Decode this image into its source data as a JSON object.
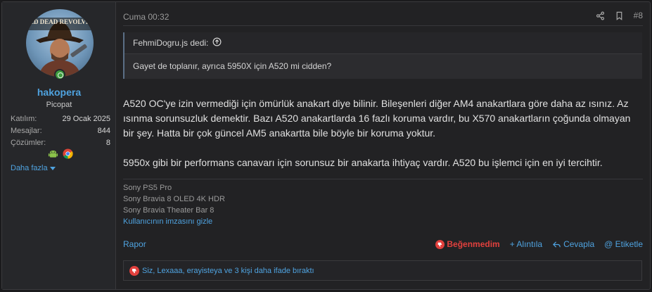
{
  "user": {
    "name": "hakopera",
    "title": "Picopat",
    "stats": [
      {
        "key": "Katılım:",
        "value": "29 Ocak 2025"
      },
      {
        "key": "Mesajlar:",
        "value": "844"
      },
      {
        "key": "Çözümler:",
        "value": "8"
      }
    ],
    "badges": [
      "android-icon",
      "chrome-icon"
    ],
    "more_label": "Daha fazla",
    "avatar_text": "RED DEAD REVOLVER"
  },
  "post": {
    "date": "Cuma 00:32",
    "number": "#8",
    "quote": {
      "author_line": "FehmiDogru.js dedi:",
      "text": "Gayet de toplanır, ayrıca 5950X için A520 mi cidden?"
    },
    "paragraphs": [
      "A520 OC'ye izin vermediği için ömürlük anakart diye bilinir. Bileşenleri diğer AM4 anakartlara göre daha az ısınız. Az ısınma sorunsuzluk demektir. Bazı A520 anakartlarda 16 fazlı koruma vardır, bu X570 anakartların çoğunda olmayan bir şey. Hatta bir çok güncel AM5 anakartta bile böyle bir koruma yoktur.",
      "5950x gibi bir performans canavarı için sorunsuz bir anakarta ihtiyaç vardır. A520 bu işlemci için en iyi tercihtir."
    ],
    "signature": [
      "Sony PS5 Pro",
      "Sony Bravia 8 OLED 4K HDR",
      "Sony Bravia Theater Bar 8"
    ],
    "signature_toggle": "Kullanıcının imzasını gizle"
  },
  "footer": {
    "report": "Rapor",
    "dislike": "Beğenmedim",
    "quote": "+ Alıntıla",
    "reply": "Cevapla",
    "tag": "@ Etiketle"
  },
  "reactions": {
    "text": "Siz, Lexaaa, erayisteya ve 3 kişi daha ifade bıraktı"
  },
  "colors": {
    "accent": "#4fa3e0",
    "dislike": "#e2403d",
    "online": "#3e9b3e"
  }
}
